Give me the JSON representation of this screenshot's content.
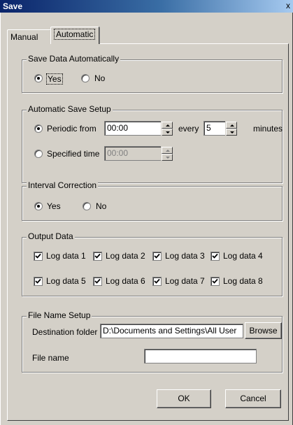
{
  "window": {
    "title": "Save",
    "close_glyph": "x"
  },
  "tabs": [
    {
      "label": "Manual",
      "active": false
    },
    {
      "label": "Automatic",
      "active": true
    }
  ],
  "save_data_automatically": {
    "title": "Save Data Automatically",
    "options": [
      {
        "label": "Yes",
        "checked": true
      },
      {
        "label": "No",
        "checked": false
      }
    ]
  },
  "automatic_save_setup": {
    "title": "Automatic Save Setup",
    "periodic": {
      "label": "Periodic from",
      "checked": true,
      "from_value": "00:00",
      "every_label": "every",
      "every_value": "5",
      "unit_label": "minutes"
    },
    "specified": {
      "label": "Specified time",
      "checked": false,
      "time_value": "00:00"
    }
  },
  "interval_correction": {
    "title": "Interval Correction",
    "options": [
      {
        "label": "Yes",
        "checked": true
      },
      {
        "label": "No",
        "checked": false
      }
    ]
  },
  "output_data": {
    "title": "Output Data",
    "items": [
      {
        "label": "Log data 1",
        "checked": true
      },
      {
        "label": "Log data 2",
        "checked": true
      },
      {
        "label": "Log data 3",
        "checked": true
      },
      {
        "label": "Log data 4",
        "checked": true
      },
      {
        "label": "Log data 5",
        "checked": true
      },
      {
        "label": "Log data 6",
        "checked": true
      },
      {
        "label": "Log data 7",
        "checked": true
      },
      {
        "label": "Log data 8",
        "checked": true
      }
    ]
  },
  "file_name_setup": {
    "title": "File Name Setup",
    "destination_label": "Destination folder",
    "destination_value": "D:\\Documents and Settings\\All User",
    "browse_label": "Browse",
    "file_name_label": "File name",
    "file_name_value": ""
  },
  "buttons": {
    "ok": "OK",
    "cancel": "Cancel"
  }
}
